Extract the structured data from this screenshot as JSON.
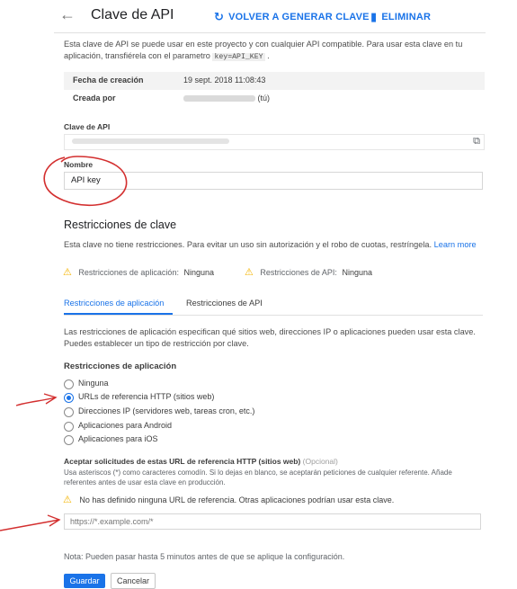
{
  "header": {
    "title": "Clave de API",
    "regenerate_label": "VOLVER A GENERAR CLAVE",
    "delete_label": "ELIMINAR"
  },
  "intro": {
    "text_before": "Esta clave de API se puede usar en este proyecto y con cualquier API compatible. Para usar esta clave en tu aplicación, transfiérela con el parametro ",
    "code": "key=API_KEY",
    "text_after": " ."
  },
  "info": {
    "created_date_label": "Fecha de creación",
    "created_date_value": "19 sept. 2018 11:08:43",
    "created_by_label": "Creada por",
    "created_by_suffix": "(tú)"
  },
  "api_key": {
    "label": "Clave de API"
  },
  "name": {
    "label": "Nombre",
    "value": "API key"
  },
  "restrictions": {
    "heading": "Restricciones de clave",
    "description": "Esta clave no tiene restricciones. Para evitar un uso sin autorización y el robo de cuotas, restríngela.",
    "learn_more": "Learn more",
    "app_restriction_label": "Restricciones de aplicación:",
    "app_restriction_value": "Ninguna",
    "api_restriction_label": "Restricciones de API:",
    "api_restriction_value": "Ninguna"
  },
  "tabs": [
    {
      "label": "Restricciones de aplicación",
      "active": true
    },
    {
      "label": "Restricciones de API",
      "active": false
    }
  ],
  "app_restrictions": {
    "description": "Las restricciones de aplicación especifican qué sitios web, direcciones IP o aplicaciones pueden usar esta clave. Puedes establecer un tipo de restricción por clave.",
    "heading": "Restricciones de aplicación",
    "options": [
      {
        "label": "Ninguna",
        "selected": false
      },
      {
        "label": "URLs de referencia HTTP (sitios web)",
        "selected": true
      },
      {
        "label": "Direcciones IP (servidores web, tareas cron, etc.)",
        "selected": false
      },
      {
        "label": "Aplicaciones para Android",
        "selected": false
      },
      {
        "label": "Aplicaciones para iOS",
        "selected": false
      }
    ]
  },
  "referrers": {
    "label": "Aceptar solicitudes de estas URL de referencia HTTP (sitios web)",
    "optional": "(Opcional)",
    "help": "Usa asteriscos (*) como caracteres comodín. Si lo dejas en blanco, se aceptarán peticiones de cualquier referente. Añade referentes antes de usar esta clave en producción.",
    "warning": "No has definido ninguna URL de referencia. Otras aplicaciones podrían usar esta clave.",
    "placeholder": "https://*.example.com/*"
  },
  "note": "Nota: Pueden pasar hasta 5 minutos antes de que se aplique la configuración.",
  "actions": {
    "save_label": "Guardar",
    "cancel_label": "Cancelar"
  },
  "colors": {
    "accent": "#1a73e8",
    "warning": "#f4b400",
    "annotation": "#d32f2f"
  }
}
